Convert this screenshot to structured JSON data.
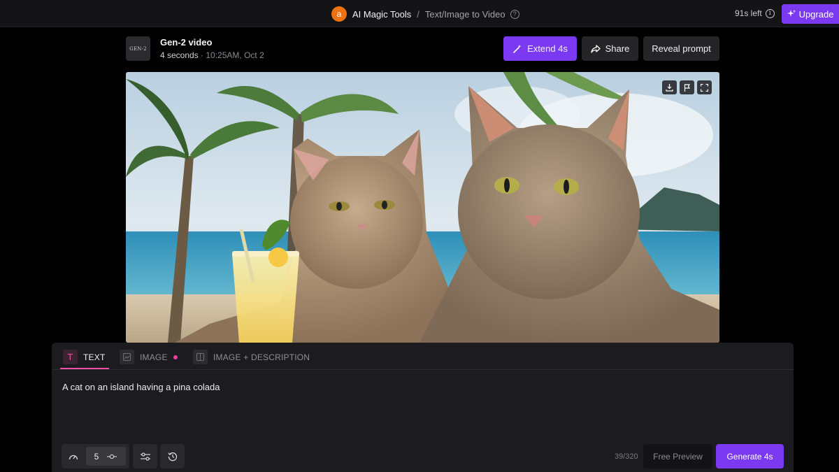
{
  "topbar": {
    "avatar_letter": "a",
    "breadcrumb_root": "AI Magic Tools",
    "breadcrumb_sep": "/",
    "breadcrumb_current": "Text/Image to Video",
    "credits": "91s left",
    "upgrade_label": "Upgrade"
  },
  "video": {
    "thumb_label": "GEN-2",
    "title": "Gen-2 video",
    "duration": "4 seconds",
    "meta_sep": " · ",
    "timestamp": "10:25AM, Oct 2",
    "controls": [
      "download-icon",
      "flag-icon",
      "fullscreen-icon"
    ]
  },
  "actions": {
    "extend_label": "Extend 4s",
    "share_label": "Share",
    "reveal_label": "Reveal prompt"
  },
  "tabs": [
    {
      "label": "TEXT",
      "icon": "text-icon",
      "active": true
    },
    {
      "label": "IMAGE",
      "icon": "image-icon",
      "active": false,
      "badge": true
    },
    {
      "label": "IMAGE + DESCRIPTION",
      "icon": "image-description-icon",
      "active": false
    }
  ],
  "prompt": {
    "text": "A cat on an island having a pina colada",
    "char_count": "39/320"
  },
  "tools": {
    "motion_value": "5"
  },
  "footer": {
    "preview_label": "Free Preview",
    "generate_label": "Generate 4s"
  },
  "colors": {
    "accent": "#7b3af2",
    "tab_active": "#f04fa5",
    "avatar": "#f0720f"
  }
}
